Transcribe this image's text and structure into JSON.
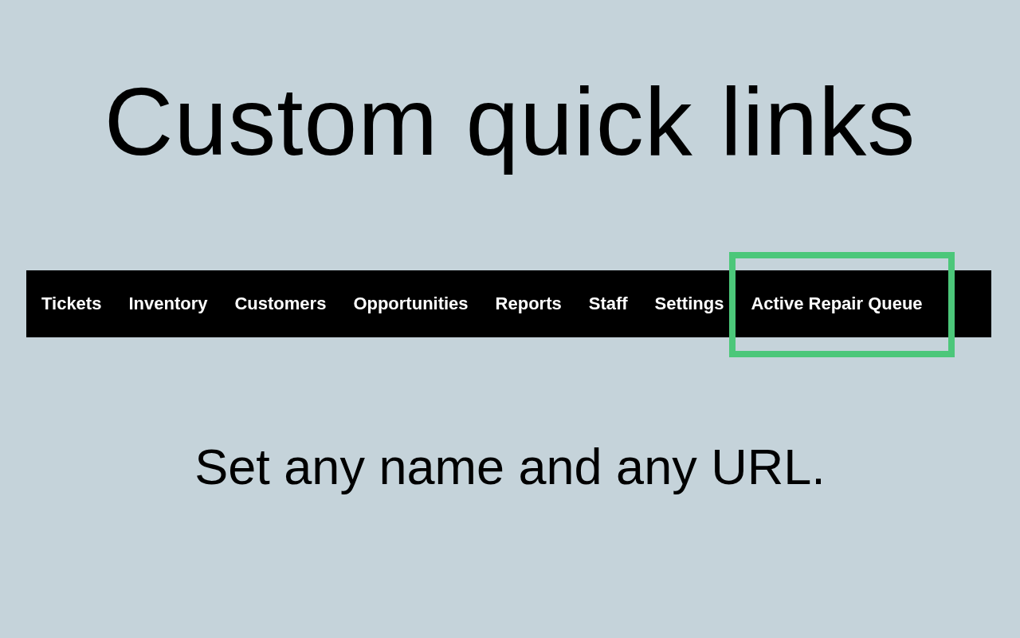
{
  "title": "Custom quick links",
  "nav": {
    "items": [
      {
        "label": "Tickets",
        "highlighted": false
      },
      {
        "label": "Inventory",
        "highlighted": false
      },
      {
        "label": "Customers",
        "highlighted": false
      },
      {
        "label": "Opportunities",
        "highlighted": false
      },
      {
        "label": "Reports",
        "highlighted": false
      },
      {
        "label": "Staff",
        "highlighted": false
      },
      {
        "label": "Settings",
        "highlighted": false
      },
      {
        "label": "Active Repair Queue",
        "highlighted": true
      }
    ]
  },
  "subtitle": "Set any name and any URL."
}
